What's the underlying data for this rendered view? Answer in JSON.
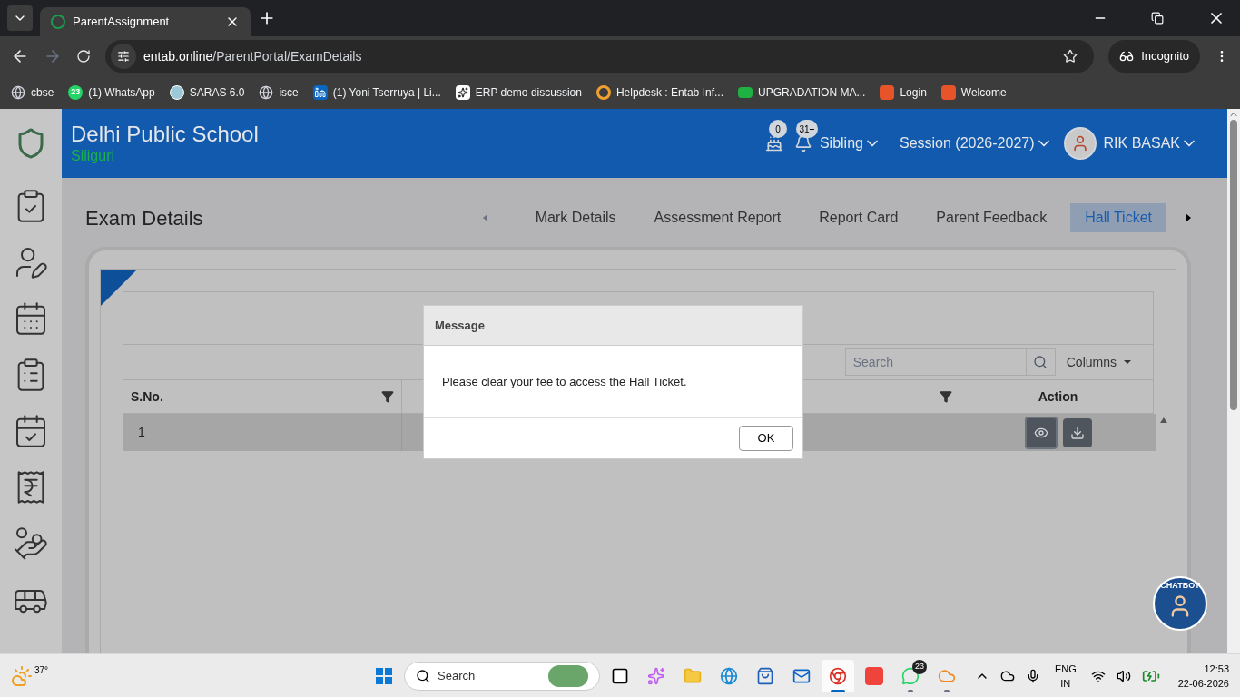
{
  "browser": {
    "tab_title": "ParentAssignment",
    "url_host": "entab.online",
    "url_path": "/ParentPortal/ExamDetails",
    "incognito": "Incognito",
    "bookmarks": [
      {
        "kind": "globe",
        "label": "cbse"
      },
      {
        "kind": "whatsapp",
        "count": "23",
        "label": "(1) WhatsApp"
      },
      {
        "kind": "saras",
        "label": "SARAS 6.0"
      },
      {
        "kind": "globe",
        "label": "isce"
      },
      {
        "kind": "linkedin",
        "label": "(1) Yoni Tserruya | Li..."
      },
      {
        "kind": "openai",
        "label": "ERP demo discussion"
      },
      {
        "kind": "helpdesk",
        "label": "Helpdesk : Entab Inf..."
      },
      {
        "kind": "upgrade",
        "label": "UPGRADATION MA..."
      },
      {
        "kind": "bbig",
        "label": "Login"
      },
      {
        "kind": "bbig",
        "label": "Welcome"
      }
    ]
  },
  "header": {
    "school": "Delhi Public School",
    "city": "Siliguri",
    "birthday_count": "0",
    "notification_count": "31+",
    "sibling": "Sibling",
    "session": "Session (2026-2027)",
    "user": "RIK BASAK"
  },
  "page": {
    "title": "Exam Details",
    "tabs": [
      {
        "label": "Mark Details",
        "selected": false
      },
      {
        "label": "Assessment Report",
        "selected": false
      },
      {
        "label": "Report Card",
        "selected": false
      },
      {
        "label": "Parent Feedback",
        "selected": false
      },
      {
        "label": "Hall Ticket",
        "selected": true
      }
    ]
  },
  "table": {
    "search_placeholder": "Search",
    "columns_button": "Columns",
    "columns": [
      {
        "label": "S.No.",
        "filter": true
      },
      {
        "filter": true
      },
      {
        "label": "Action",
        "filter": false
      }
    ],
    "rows": [
      {
        "sno": "1"
      }
    ]
  },
  "dialog": {
    "title": "Message",
    "message": "Please clear your fee to access the Hall Ticket.",
    "ok": "OK"
  },
  "chatbot": {
    "label": "CHATBOT"
  },
  "taskbar": {
    "temperature": "37°",
    "search_placeholder": "Search",
    "whatsapp_count": "23",
    "language": "ENG",
    "region": "IN",
    "time": "12:53",
    "date": "22-06-2026",
    "apps": [
      {
        "kind": "taskview",
        "selected": false,
        "running": false
      },
      {
        "kind": "copilot",
        "selected": false,
        "running": false
      },
      {
        "kind": "folder",
        "selected": false,
        "running": false
      },
      {
        "kind": "edge",
        "selected": false,
        "running": false
      },
      {
        "kind": "store",
        "selected": false,
        "running": false
      },
      {
        "kind": "outlook",
        "selected": false,
        "running": false
      },
      {
        "kind": "chrome",
        "selected": true,
        "running": true
      },
      {
        "kind": "anydesk",
        "selected": false,
        "running": false
      },
      {
        "kind": "whatsapp",
        "selected": false,
        "running": true
      },
      {
        "kind": "cloud",
        "selected": false,
        "running": true
      }
    ]
  }
}
